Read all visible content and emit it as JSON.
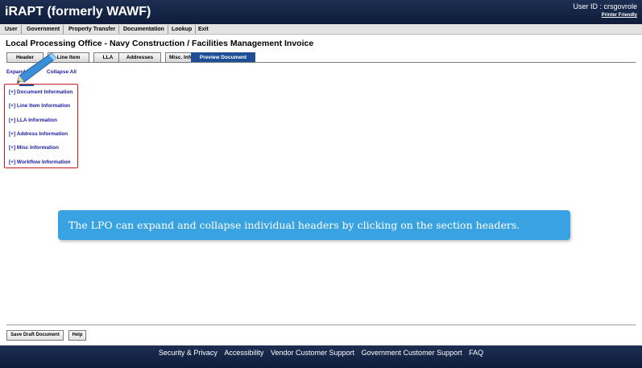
{
  "app_title": "iRAPT (formerly WAWF)",
  "user": {
    "user_id_text": "User ID : crsgovrole",
    "printer_friendly": "Printer Friendly"
  },
  "menu": {
    "items": [
      "User",
      "Government",
      "Property Transfer",
      "Documentation",
      "Lookup",
      "Exit"
    ]
  },
  "page_title": "Local Processing Office - Navy Construction / Facilities Management Invoice",
  "tabs": {
    "items": [
      "Header",
      "Line Item",
      "LLA",
      "Addresses",
      "Misc. Info",
      "Preview Document"
    ],
    "active": "Preview Document"
  },
  "links": {
    "expand_all": "Expand All",
    "collapse_all": "Collapse All"
  },
  "sections": {
    "items": [
      "[+] Document Information",
      "[+] Line Item Information",
      "[+] LLA Information",
      "[+] Address Information",
      "[+] Misc Information",
      "[+] Workflow Information"
    ]
  },
  "callout": {
    "text": "The LPO can expand and collapse individual headers by clicking on the section headers."
  },
  "buttons": {
    "save_draft": "Save Draft Document",
    "help": "Help"
  },
  "footer": {
    "links": [
      "Security & Privacy",
      "Accessibility",
      "Vendor Customer Support",
      "Government Customer Support",
      "FAQ"
    ]
  },
  "colors": {
    "header_bg": "#1d2e52",
    "active_tab": "#1e4f96",
    "link": "#1a1aa8",
    "highlight_border": "#c9191e",
    "callout_bg": "#39a3e2"
  },
  "icons": [
    "pencil-pointer-icon"
  ]
}
